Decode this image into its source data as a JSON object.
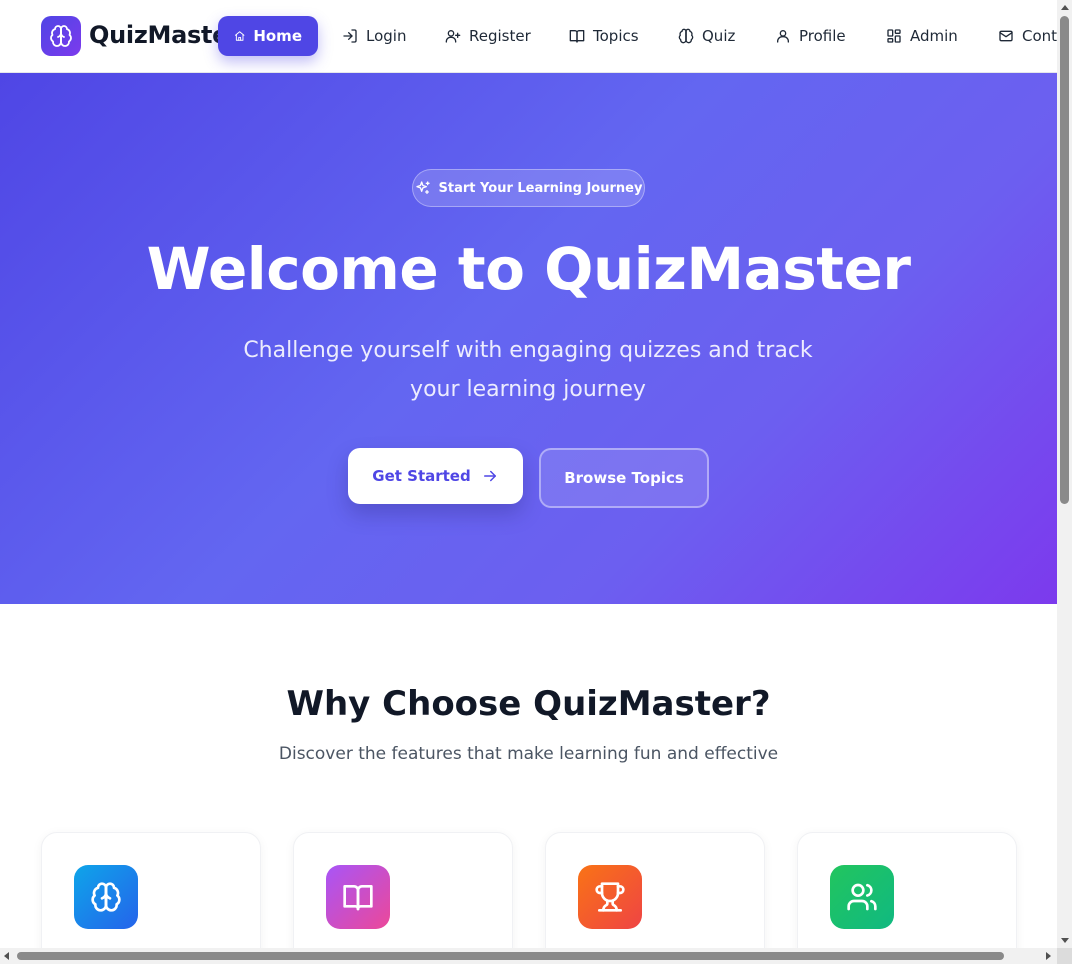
{
  "brand": {
    "name": "QuizMaster",
    "icon": "brain-icon"
  },
  "nav": {
    "items": [
      {
        "label": "Home",
        "icon": "home-icon",
        "active": true
      },
      {
        "label": "Login",
        "icon": "login-icon"
      },
      {
        "label": "Register",
        "icon": "user-plus-icon"
      },
      {
        "label": "Topics",
        "icon": "book-open-icon"
      },
      {
        "label": "Quiz",
        "icon": "brain-icon"
      },
      {
        "label": "Profile",
        "icon": "user-icon"
      },
      {
        "label": "Admin",
        "icon": "dashboard-icon"
      },
      {
        "label": "Cont",
        "icon": "mail-icon"
      }
    ]
  },
  "hero": {
    "badge": "Start Your Learning Journey",
    "title": "Welcome to QuizMaster",
    "subtitle": "Challenge yourself with engaging quizzes and track your learning journey",
    "primary_button": "Get Started",
    "secondary_button": "Browse Topics"
  },
  "features": {
    "title": "Why Choose QuizMaster?",
    "subtitle": "Discover the features that make learning fun and effective",
    "cards": [
      {
        "icon": "brain-icon",
        "color_from": "#0ea5e9",
        "color_to": "#2563eb"
      },
      {
        "icon": "book-open-icon",
        "color_from": "#a855f7",
        "color_to": "#ec4899"
      },
      {
        "icon": "trophy-icon",
        "color_from": "#f97316",
        "color_to": "#ef4444"
      },
      {
        "icon": "users-icon",
        "color_from": "#22c55e",
        "color_to": "#10b981"
      }
    ]
  },
  "colors": {
    "primary": "#4f46e5",
    "hero_gradient_start": "#4f46e5",
    "hero_gradient_end": "#7c3aed"
  }
}
